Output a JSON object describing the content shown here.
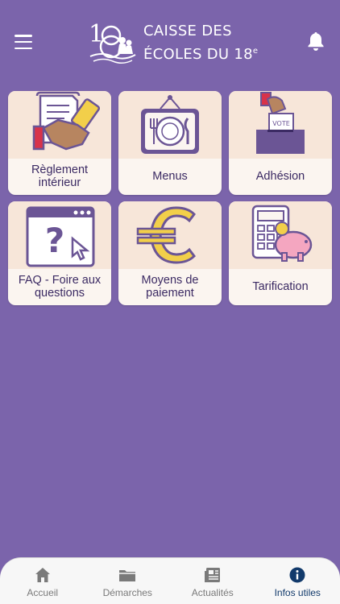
{
  "header": {
    "menu_icon": "hamburger-menu-icon",
    "logo_icon": "caisse-des-ecoles-logo",
    "title_line1": "CAISSE DES",
    "title_line2_main": "ÉCOLES DU 18",
    "title_line2_sup": "e",
    "notification_icon": "bell-icon"
  },
  "tiles": [
    {
      "label": "Règlement intérieur",
      "icon": "handshake-document-icon"
    },
    {
      "label": "Menus",
      "icon": "plate-fork-knife-icon"
    },
    {
      "label": "Adhésion",
      "icon": "vote-box-icon"
    },
    {
      "label": "FAQ - Foire aux questions",
      "icon": "question-window-icon"
    },
    {
      "label": "Moyens de paiement",
      "icon": "euro-icon"
    },
    {
      "label": "Tarification",
      "icon": "calculator-piggy-bank-icon"
    }
  ],
  "tabbar": {
    "tabs": [
      {
        "label": "Accueil",
        "icon": "home-icon",
        "active": false
      },
      {
        "label": "Démarches",
        "icon": "folder-icon",
        "active": false
      },
      {
        "label": "Actualités",
        "icon": "newspaper-icon",
        "active": false
      },
      {
        "label": "Infos utiles",
        "icon": "info-icon",
        "active": true
      }
    ]
  },
  "colors": {
    "background": "#7b64ab",
    "tile_bg": "#fbf5f0",
    "tile_art_bg": "#f7e6d9",
    "tile_text": "#3b2a63",
    "tab_active": "#123a6b",
    "tab_inactive": "#7a7a7a",
    "icon_purple": "#6b5595",
    "icon_yellow": "#f2cf4a"
  }
}
